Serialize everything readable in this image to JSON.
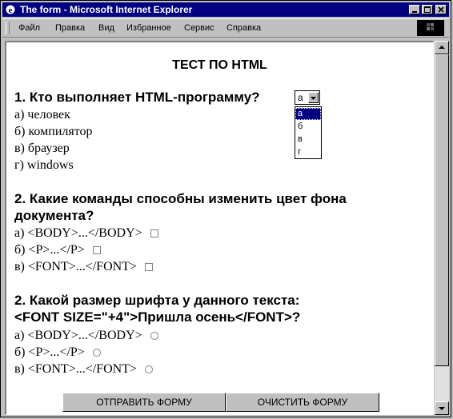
{
  "window": {
    "title": "The form - Microsoft Internet Explorer"
  },
  "menu": {
    "items": [
      "Файл",
      "Правка",
      "Вид",
      "Избранное",
      "Сервис",
      "Справка"
    ]
  },
  "page": {
    "heading": "ТЕСТ ПО HTML",
    "q1": {
      "text": "1. Кто выполняет HTML-программу?",
      "options": [
        "а) человек",
        "б) компилятор",
        "в) браузер",
        "г) windows"
      ],
      "select_value": "а",
      "dropdown_options": [
        "а",
        "б",
        "в",
        "г"
      ],
      "dropdown_selected_index": 0
    },
    "q2": {
      "line1": "2. Какие команды способны изменить цвет фона",
      "line2": "документа?",
      "options": [
        "а) <BODY>...</BODY>",
        "б) <P>...</P>",
        "в) <FONT>...</FONT>"
      ]
    },
    "q3": {
      "line1": "2. Какой размер шрифта у данного текста:",
      "line2": "<FONT SIZE=\"+4\">Пришла осень</FONT>?",
      "options": [
        "а) <BODY>...</BODY>",
        "б) <P>...</P>",
        "в) <FONT>...</FONT>"
      ]
    },
    "submit_label": "ОТПРАВИТЬ ФОРМУ",
    "reset_label": "ОЧИСТИТЬ ФОРМУ"
  }
}
